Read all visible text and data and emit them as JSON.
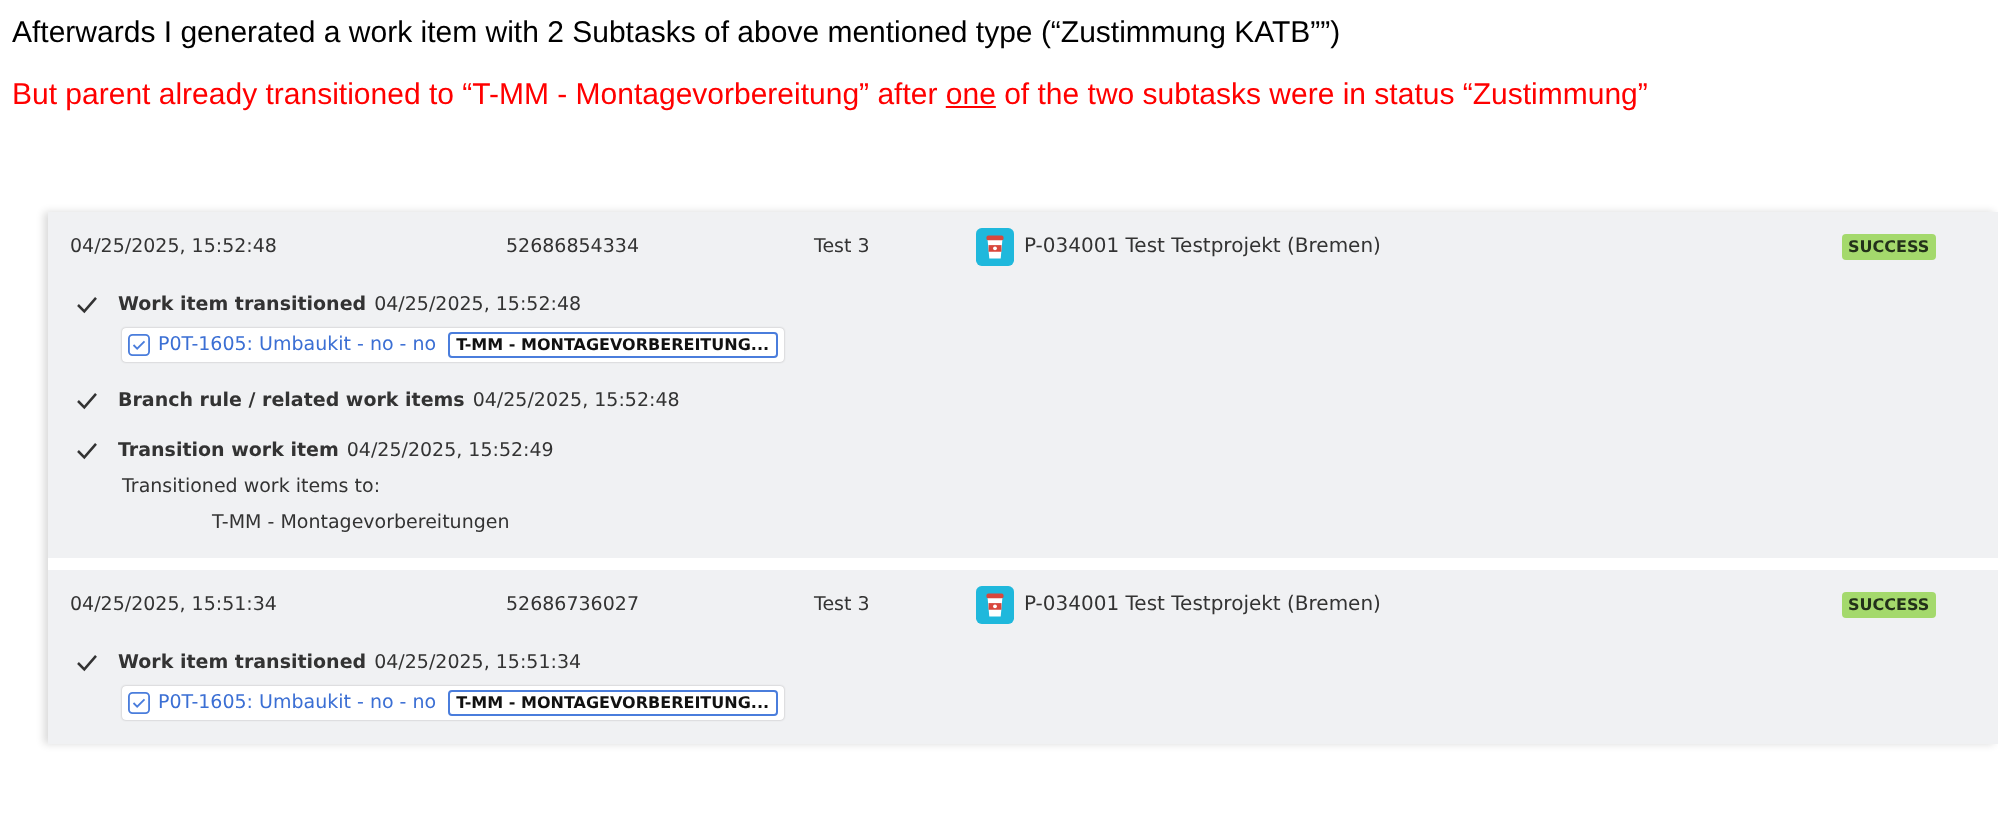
{
  "notes": [
    {
      "color": "#000000",
      "parts": [
        {
          "text": "Afterwards I generated a work item with 2 Subtasks of above mentioned type (“Zustimmung KATB””)",
          "underlined": false
        }
      ]
    },
    {
      "color": "#ff0000",
      "parts": [
        {
          "text": "But parent already transitioned to “T-MM - Montagevorbereitung” after ",
          "underlined": false
        },
        {
          "text": "one",
          "underlined": true
        },
        {
          "text": " of the two subtasks were in status “Zustimmung”",
          "underlined": false
        }
      ]
    }
  ],
  "log_entries": [
    {
      "date": "04/25/2025, 15:52:48",
      "id": "52686854334",
      "actor": "Test 3",
      "project": "P-034001 Test Testprojekt (Bremen)",
      "status": "SUCCESS",
      "steps": [
        {
          "kind": "transitioned",
          "title": "Work item transitioned",
          "time": "04/25/2025, 15:52:48",
          "link": "P0T-1605: Umbaukit - no - no",
          "lozenge": "T-MM - MONTAGEVORBEREITUNG..."
        },
        {
          "kind": "plain",
          "title": "Branch rule / related work items",
          "time": "04/25/2025, 15:52:48"
        },
        {
          "kind": "transition",
          "title": "Transition work item",
          "time": "04/25/2025, 15:52:49",
          "label": "Transitioned work items to:",
          "target": "T-MM - Montagevorbereitungen"
        }
      ]
    },
    {
      "date": "04/25/2025, 15:51:34",
      "id": "52686736027",
      "actor": "Test 3",
      "project": "P-034001 Test Testprojekt (Bremen)",
      "status": "SUCCESS",
      "steps": [
        {
          "kind": "transitioned",
          "title": "Work item transitioned",
          "time": "04/25/2025, 15:51:34",
          "link": "P0T-1605: Umbaukit - no - no",
          "lozenge": "T-MM - MONTAGEVORBEREITUNG..."
        }
      ]
    }
  ]
}
